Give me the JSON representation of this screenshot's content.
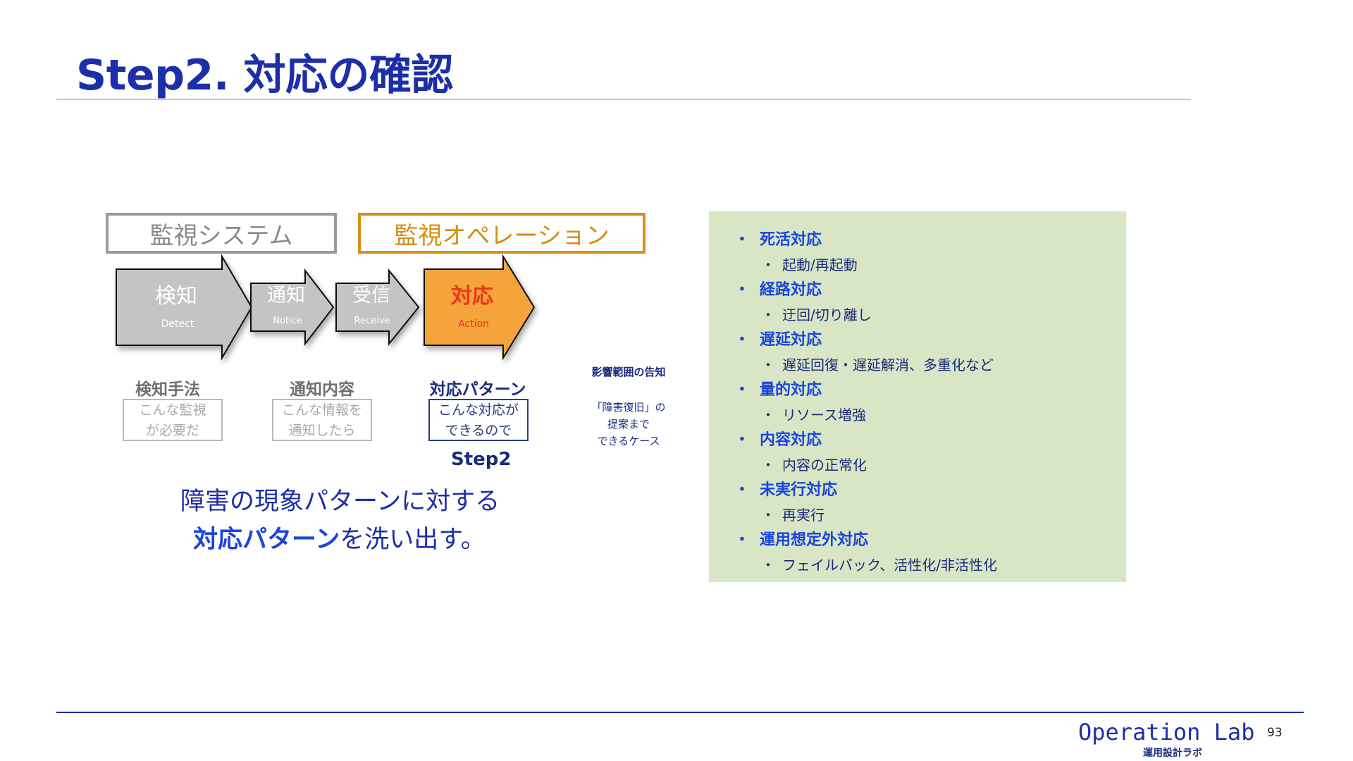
{
  "slide": {
    "title": "Step2. 対応の確認",
    "page_number": "93"
  },
  "header_boxes": {
    "monitoring_system": "監視システム",
    "monitoring_operation": "監視オペレーション"
  },
  "flow": {
    "steps": [
      {
        "label": "検知",
        "sub": "Detect",
        "state": "inactive"
      },
      {
        "label": "通知",
        "sub": "Notice",
        "state": "inactive"
      },
      {
        "label": "受信",
        "sub": "Receive",
        "state": "inactive"
      },
      {
        "label": "対応",
        "sub": "Action",
        "state": "active"
      }
    ],
    "details": [
      {
        "title": "検知手法",
        "line1": "こんな監視",
        "line2": "が必要だ"
      },
      {
        "title": "通知内容",
        "line1": "こんな情報を",
        "line2": "通知したら"
      },
      {
        "title": "対応パターン",
        "line1": "こんな対応が",
        "line2": "できるので"
      }
    ],
    "step_label": "Step2"
  },
  "side_note": {
    "heading": "影響範囲の告知",
    "line1": "「障害復旧」の",
    "line2": "提案まで",
    "line3": "できるケース"
  },
  "summary": {
    "line1": "障害の現象パターンに対する",
    "line2_highlight": "対応パターン",
    "line2_rest": "を洗い出す。"
  },
  "patterns": [
    {
      "title": "死活対応",
      "detail": "起動/再起動"
    },
    {
      "title": "経路対応",
      "detail": "迂回/切り離し"
    },
    {
      "title": "遅延対応",
      "detail": "遅延回復・遅延解消、多重化など"
    },
    {
      "title": "量的対応",
      "detail": "リソース増強"
    },
    {
      "title": "内容対応",
      "detail": "内容の正常化"
    },
    {
      "title": "未実行対応",
      "detail": "再実行"
    },
    {
      "title": "運用想定外対応",
      "detail": "フェイルバック、活性化/非活性化"
    }
  ],
  "bullets": {
    "main": "・",
    "sub": "・"
  },
  "footer": {
    "logo": "Operation Lab",
    "logo_sub": "運用設計ラボ"
  },
  "colors": {
    "title_blue": "#1c2fa8",
    "highlight_blue": "#1a45dd",
    "action_orange": "#f5a33a",
    "inactive_gray": "#c4c4c4",
    "panel_green": "#d8e6c6"
  }
}
